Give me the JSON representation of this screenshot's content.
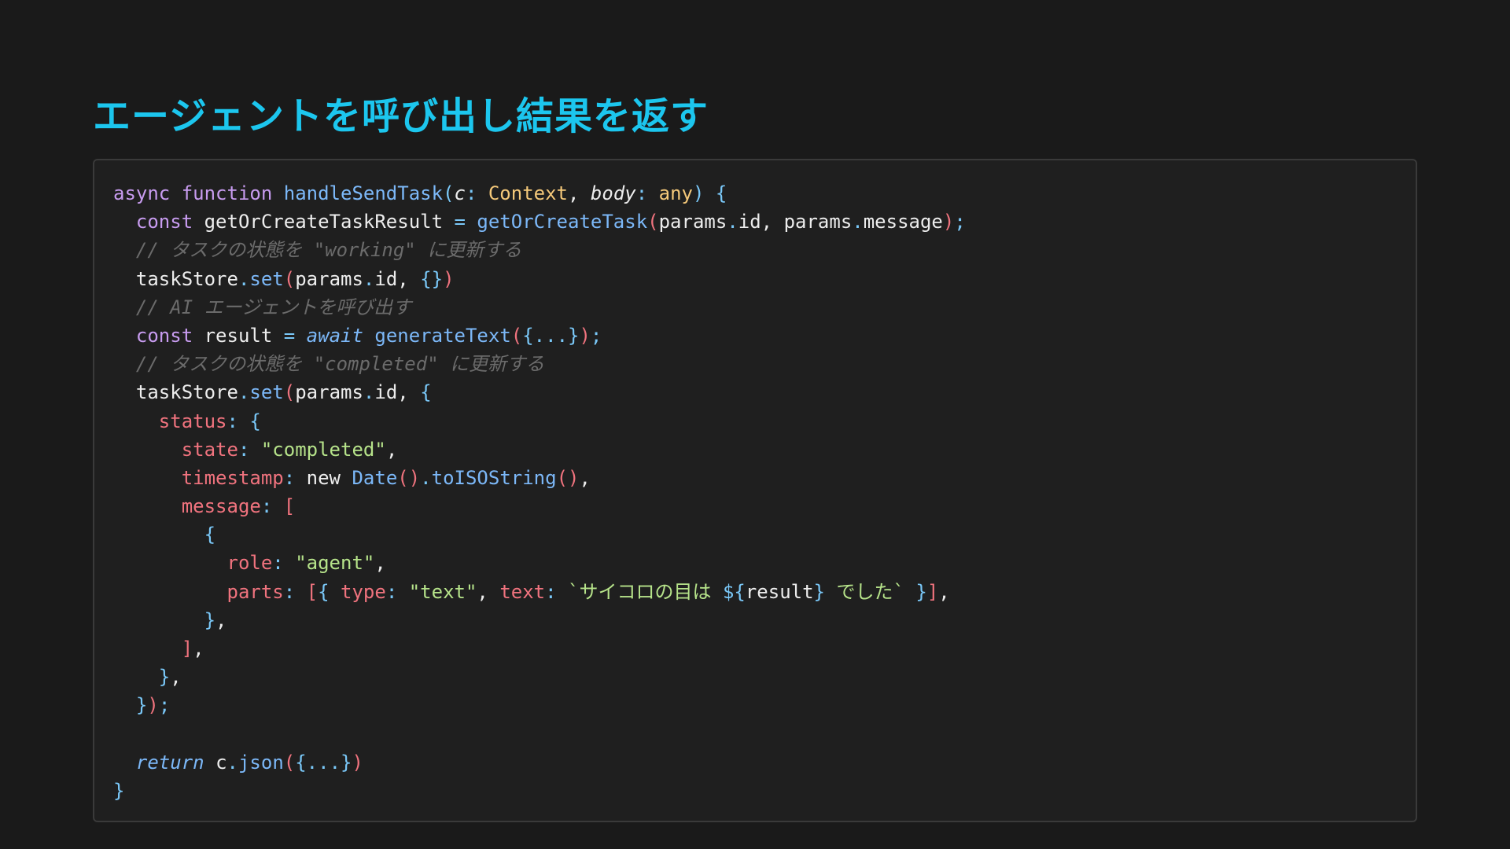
{
  "title": "エージェントを呼び出し結果を返す",
  "code_lines": [
    [
      {
        "t": "async",
        "c": "kw"
      },
      {
        "t": " "
      },
      {
        "t": "function",
        "c": "kw"
      },
      {
        "t": " "
      },
      {
        "t": "handleSendTask",
        "c": "fn"
      },
      {
        "t": "(",
        "c": "br-c"
      },
      {
        "t": "c",
        "c": "plain it"
      },
      {
        "t": ": ",
        "c": "op"
      },
      {
        "t": "Context",
        "c": "ty"
      },
      {
        "t": ", ",
        "c": "plain"
      },
      {
        "t": "body",
        "c": "plain it"
      },
      {
        "t": ": ",
        "c": "op"
      },
      {
        "t": "any",
        "c": "ty"
      },
      {
        "t": ")",
        "c": "br-c"
      },
      {
        "t": " "
      },
      {
        "t": "{",
        "c": "br-c"
      }
    ],
    [
      {
        "t": "  "
      },
      {
        "t": "const",
        "c": "kw"
      },
      {
        "t": " "
      },
      {
        "t": "getOrCreateTaskResult",
        "c": "plain"
      },
      {
        "t": " = ",
        "c": "op"
      },
      {
        "t": "getOrCreateTask",
        "c": "fn"
      },
      {
        "t": "(",
        "c": "br-p"
      },
      {
        "t": "params",
        "c": "plain"
      },
      {
        "t": ".",
        "c": "op"
      },
      {
        "t": "id",
        "c": "plain"
      },
      {
        "t": ", ",
        "c": "plain"
      },
      {
        "t": "params",
        "c": "plain"
      },
      {
        "t": ".",
        "c": "op"
      },
      {
        "t": "message",
        "c": "plain"
      },
      {
        "t": ")",
        "c": "br-p"
      },
      {
        "t": ";",
        "c": "op"
      }
    ],
    [
      {
        "t": "  "
      },
      {
        "t": "// タスクの状態を \"working\" に更新する",
        "c": "cm"
      }
    ],
    [
      {
        "t": "  "
      },
      {
        "t": "taskStore",
        "c": "plain"
      },
      {
        "t": ".",
        "c": "op"
      },
      {
        "t": "set",
        "c": "fn"
      },
      {
        "t": "(",
        "c": "br-p"
      },
      {
        "t": "params",
        "c": "plain"
      },
      {
        "t": ".",
        "c": "op"
      },
      {
        "t": "id",
        "c": "plain"
      },
      {
        "t": ", ",
        "c": "plain"
      },
      {
        "t": "{}",
        "c": "br-c"
      },
      {
        "t": ")",
        "c": "br-p"
      }
    ],
    [
      {
        "t": "  "
      },
      {
        "t": "// AI エージェントを呼び出す",
        "c": "cm"
      }
    ],
    [
      {
        "t": "  "
      },
      {
        "t": "const",
        "c": "kw"
      },
      {
        "t": " "
      },
      {
        "t": "result",
        "c": "plain"
      },
      {
        "t": " = ",
        "c": "op"
      },
      {
        "t": "await",
        "c": "fn it"
      },
      {
        "t": " "
      },
      {
        "t": "generateText",
        "c": "fn"
      },
      {
        "t": "(",
        "c": "br-p"
      },
      {
        "t": "{...}",
        "c": "br-c"
      },
      {
        "t": ")",
        "c": "br-p"
      },
      {
        "t": ";",
        "c": "op"
      }
    ],
    [
      {
        "t": "  "
      },
      {
        "t": "// タスクの状態を \"completed\" に更新する",
        "c": "cm"
      }
    ],
    [
      {
        "t": "  "
      },
      {
        "t": "taskStore",
        "c": "plain"
      },
      {
        "t": ".",
        "c": "op"
      },
      {
        "t": "set",
        "c": "fn"
      },
      {
        "t": "(",
        "c": "br-p"
      },
      {
        "t": "params",
        "c": "plain"
      },
      {
        "t": ".",
        "c": "op"
      },
      {
        "t": "id",
        "c": "plain"
      },
      {
        "t": ", ",
        "c": "plain"
      },
      {
        "t": "{",
        "c": "br-c"
      }
    ],
    [
      {
        "t": "    "
      },
      {
        "t": "status",
        "c": "prop"
      },
      {
        "t": ": ",
        "c": "op"
      },
      {
        "t": "{",
        "c": "br-c"
      }
    ],
    [
      {
        "t": "      "
      },
      {
        "t": "state",
        "c": "prop"
      },
      {
        "t": ": ",
        "c": "op"
      },
      {
        "t": "\"completed\"",
        "c": "str"
      },
      {
        "t": ",",
        "c": "plain"
      }
    ],
    [
      {
        "t": "      "
      },
      {
        "t": "timestamp",
        "c": "prop"
      },
      {
        "t": ": ",
        "c": "op"
      },
      {
        "t": "new",
        "c": "plain"
      },
      {
        "t": " "
      },
      {
        "t": "Date",
        "c": "fn"
      },
      {
        "t": "()",
        "c": "br-p"
      },
      {
        "t": ".",
        "c": "op"
      },
      {
        "t": "toISOString",
        "c": "fn"
      },
      {
        "t": "()",
        "c": "br-p"
      },
      {
        "t": ",",
        "c": "plain"
      }
    ],
    [
      {
        "t": "      "
      },
      {
        "t": "message",
        "c": "prop"
      },
      {
        "t": ": ",
        "c": "op"
      },
      {
        "t": "[",
        "c": "br-p"
      }
    ],
    [
      {
        "t": "        "
      },
      {
        "t": "{",
        "c": "br-c"
      }
    ],
    [
      {
        "t": "          "
      },
      {
        "t": "role",
        "c": "prop"
      },
      {
        "t": ": ",
        "c": "op"
      },
      {
        "t": "\"agent\"",
        "c": "str"
      },
      {
        "t": ",",
        "c": "plain"
      }
    ],
    [
      {
        "t": "          "
      },
      {
        "t": "parts",
        "c": "prop"
      },
      {
        "t": ": ",
        "c": "op"
      },
      {
        "t": "[",
        "c": "br-p"
      },
      {
        "t": "{",
        "c": "br-c"
      },
      {
        "t": " "
      },
      {
        "t": "type",
        "c": "prop"
      },
      {
        "t": ": ",
        "c": "op"
      },
      {
        "t": "\"text\"",
        "c": "str"
      },
      {
        "t": ", ",
        "c": "plain"
      },
      {
        "t": "text",
        "c": "prop"
      },
      {
        "t": ": ",
        "c": "op"
      },
      {
        "t": "`サイコロの目は ",
        "c": "str"
      },
      {
        "t": "${",
        "c": "op"
      },
      {
        "t": "result",
        "c": "plain"
      },
      {
        "t": "}",
        "c": "op"
      },
      {
        "t": " でした`",
        "c": "str"
      },
      {
        "t": " "
      },
      {
        "t": "}",
        "c": "br-c"
      },
      {
        "t": "]",
        "c": "br-p"
      },
      {
        "t": ",",
        "c": "plain"
      }
    ],
    [
      {
        "t": "        "
      },
      {
        "t": "}",
        "c": "br-c"
      },
      {
        "t": ",",
        "c": "plain"
      }
    ],
    [
      {
        "t": "      "
      },
      {
        "t": "]",
        "c": "br-p"
      },
      {
        "t": ",",
        "c": "plain"
      }
    ],
    [
      {
        "t": "    "
      },
      {
        "t": "}",
        "c": "br-c"
      },
      {
        "t": ",",
        "c": "plain"
      }
    ],
    [
      {
        "t": "  "
      },
      {
        "t": "}",
        "c": "br-c"
      },
      {
        "t": ")",
        "c": "br-p"
      },
      {
        "t": ";",
        "c": "op"
      }
    ],
    [],
    [
      {
        "t": "  "
      },
      {
        "t": "return",
        "c": "fn it"
      },
      {
        "t": " "
      },
      {
        "t": "c",
        "c": "plain"
      },
      {
        "t": ".",
        "c": "op"
      },
      {
        "t": "json",
        "c": "fn"
      },
      {
        "t": "(",
        "c": "br-p"
      },
      {
        "t": "{...}",
        "c": "br-c"
      },
      {
        "t": ")",
        "c": "br-p"
      }
    ],
    [
      {
        "t": "}",
        "c": "br-c"
      }
    ]
  ],
  "colors": {
    "background": "#1a1a1a",
    "panel": "#1f1f1f",
    "title": "#1cc6ee"
  }
}
